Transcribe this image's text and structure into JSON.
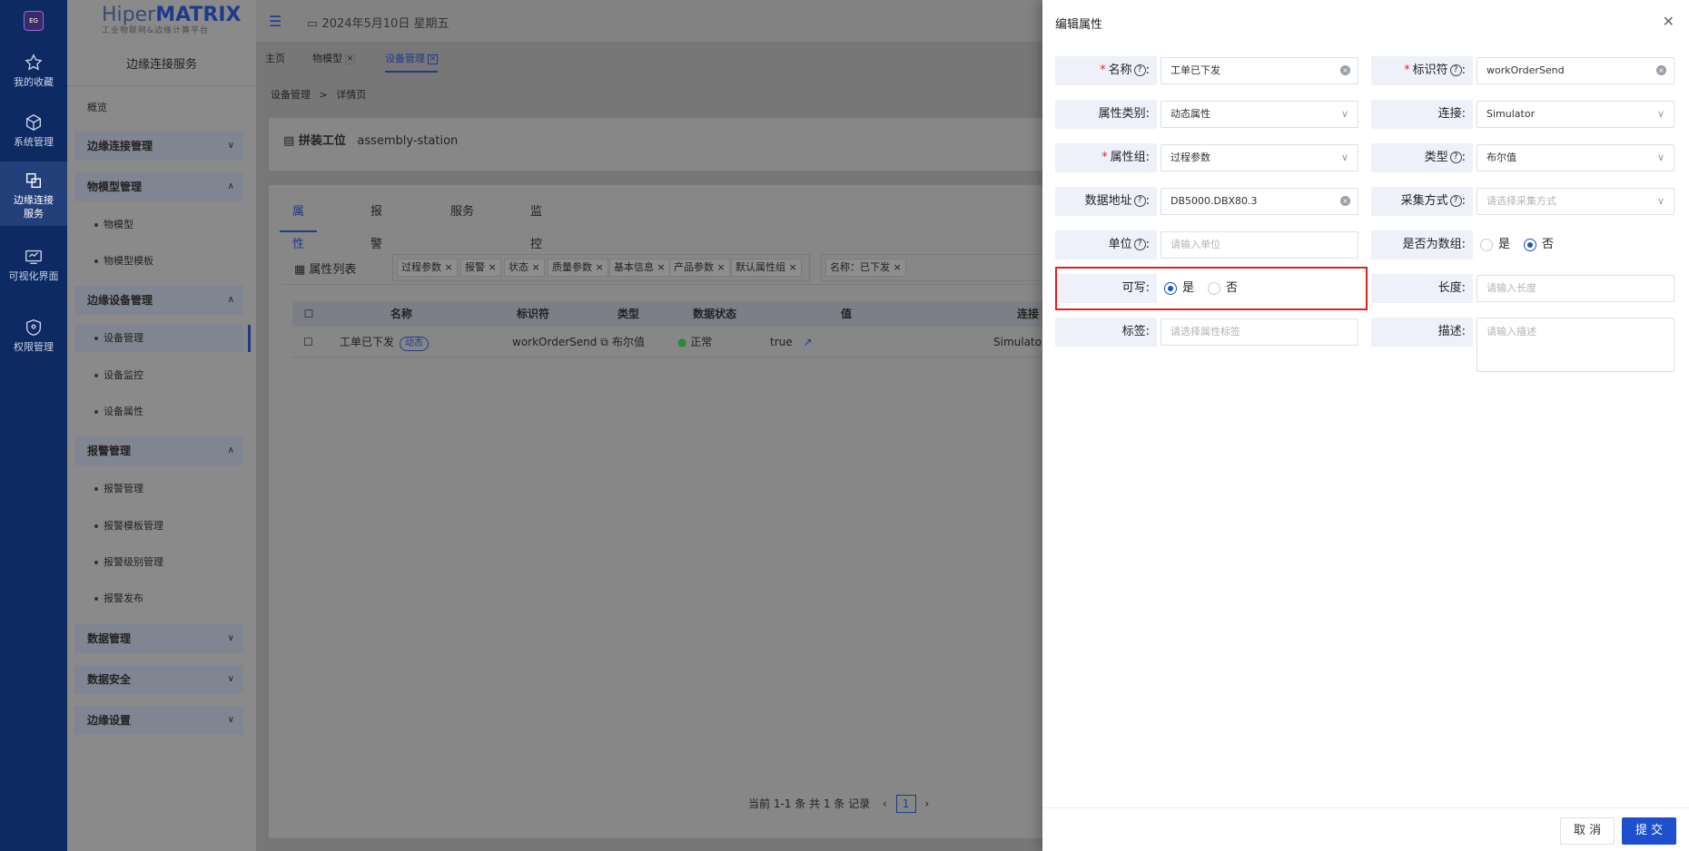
{
  "rail": {
    "logo": "EG",
    "items": [
      {
        "label": "我的收藏"
      },
      {
        "label": "系统管理"
      },
      {
        "label": "边缘连接服务"
      },
      {
        "label": "可视化界面"
      },
      {
        "label": "权限管理"
      }
    ]
  },
  "brand": {
    "name_a": "Hiper",
    "name_b": "MATRIX",
    "subtitle": "工业物联网&边缘计算平台"
  },
  "sidebar": {
    "title": "边缘连接服务",
    "items": [
      {
        "label": "概览"
      },
      {
        "label": "边缘连接管理"
      },
      {
        "label": "物模型管理"
      },
      {
        "label": "物模型"
      },
      {
        "label": "物模型模板"
      },
      {
        "label": "边缘设备管理"
      },
      {
        "label": "设备管理"
      },
      {
        "label": "设备监控"
      },
      {
        "label": "设备属性"
      },
      {
        "label": "报警管理"
      },
      {
        "label": "报警管理"
      },
      {
        "label": "报警模板管理"
      },
      {
        "label": "报警级别管理"
      },
      {
        "label": "报警发布"
      },
      {
        "label": "数据管理"
      },
      {
        "label": "数据安全"
      },
      {
        "label": "边缘设置"
      }
    ]
  },
  "topbar": {
    "date": "2024年5月10日 星期五"
  },
  "tabs": [
    {
      "label": "主页"
    },
    {
      "label": "物模型"
    },
    {
      "label": "设备管理"
    }
  ],
  "breadcrumb": {
    "a": "设备管理",
    "sep": ">",
    "b": "详情页"
  },
  "detail": {
    "title": "拼装工位",
    "code": "assembly-station"
  },
  "inner_tabs": [
    {
      "label": "属性"
    },
    {
      "label": "报警"
    },
    {
      "label": "服务"
    },
    {
      "label": "监控"
    }
  ],
  "list": {
    "title": "属性列表",
    "chips": [
      "过程参数",
      "报警",
      "状态",
      "质量参数",
      "基本信息",
      "产品参数",
      "默认属性组"
    ],
    "filter_chip": "名称：已下发",
    "columns": [
      "名称",
      "标识符",
      "类型",
      "数据状态",
      "值",
      "连接"
    ],
    "row": {
      "name": "工单已下发",
      "tag": "动态",
      "id": "workOrderSend",
      "type": "布尔值",
      "status": "正常",
      "value": "true",
      "conn": "Simulator"
    },
    "pager": {
      "text": "当前 1-1 条 共 1 条 记录",
      "page": "1"
    }
  },
  "drawer": {
    "title": "编辑属性",
    "fields": {
      "name": {
        "label": "名称",
        "value": "工单已下发"
      },
      "ident": {
        "label": "标识符",
        "value": "workOrderSend"
      },
      "category": {
        "label": "属性类别:",
        "value": "动态属性"
      },
      "conn": {
        "label": "连接:",
        "value": "Simulator"
      },
      "group": {
        "label": "属性组:",
        "value": "过程参数"
      },
      "type": {
        "label": "类型",
        "value": "布尔值"
      },
      "addr": {
        "label": "数据地址",
        "value": "DB5000.DBX80.3"
      },
      "collect": {
        "label": "采集方式",
        "placeholder": "请选择采集方式"
      },
      "unit": {
        "label": "单位",
        "placeholder": "请输入单位"
      },
      "is_array": {
        "label": "是否为数组:",
        "yes": "是",
        "no": "否",
        "selected": "否"
      },
      "writable": {
        "label": "可写:",
        "yes": "是",
        "no": "否",
        "selected": "是"
      },
      "length": {
        "label": "长度:",
        "placeholder": "请输入长度"
      },
      "tags": {
        "label": "标签:",
        "placeholder": "请选择属性标签"
      },
      "desc": {
        "label": "描述:",
        "placeholder": "请输入描述"
      }
    },
    "cancel": "取 消",
    "submit": "提 交"
  },
  "colors": {
    "primary": "#1e4fcf",
    "highlight": "#e02020",
    "required": "#e0282e"
  }
}
